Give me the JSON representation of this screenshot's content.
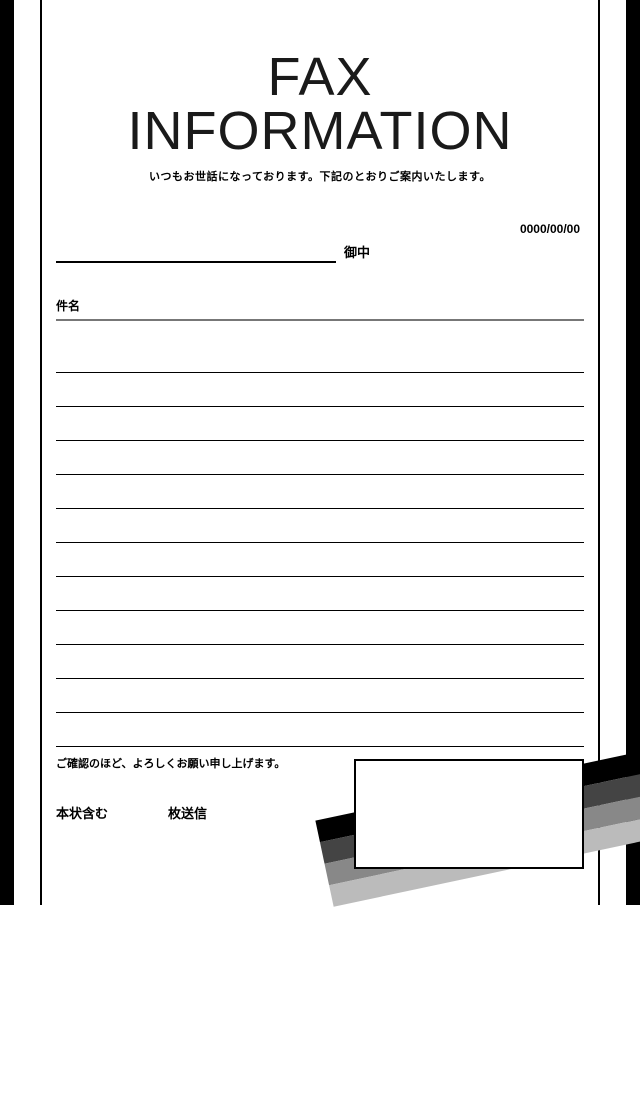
{
  "title": "FAX INFORMATION",
  "subtitle": "いつもお世話になっております。下記のとおりご案内いたします。",
  "date": "0000/00/00",
  "recipient_suffix": "御中",
  "subject_label": "件名",
  "confirm_text": "ご確認のほど、よろしくお願い申し上げます。",
  "pages_prefix": "本状含む",
  "pages_suffix": "枚送信",
  "body_line_count": 12
}
